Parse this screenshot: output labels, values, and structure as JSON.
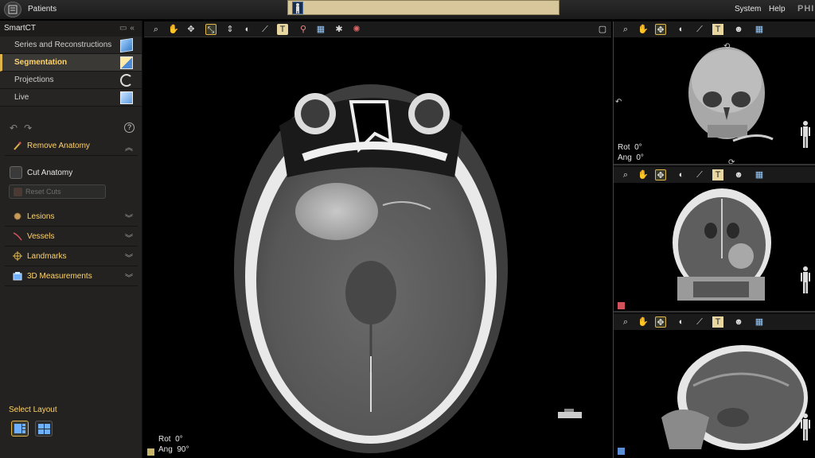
{
  "topbar": {
    "patients_label": "Patients",
    "system_label": "System",
    "help_label": "Help",
    "brand_label": "PHI"
  },
  "left_panel": {
    "title": "SmartCT",
    "nav": [
      {
        "label": "Series and Reconstructions",
        "icon": "cube-icon"
      },
      {
        "label": "Segmentation",
        "icon": "segmentation-cube-icon",
        "active": true
      },
      {
        "label": "Projections",
        "icon": "rotate-icon"
      },
      {
        "label": "Live",
        "icon": "live-icon"
      }
    ],
    "help_glyph": "?",
    "remove_anatomy": "Remove Anatomy",
    "cut_anatomy": "Cut Anatomy",
    "reset_cuts": "Reset Cuts",
    "sections": [
      {
        "label": "Lesions",
        "icon": "lesion-icon"
      },
      {
        "label": "Vessels",
        "icon": "vessel-icon"
      },
      {
        "label": "Landmarks",
        "icon": "landmark-icon"
      },
      {
        "label": "3D Measurements",
        "icon": "measurement-icon"
      }
    ],
    "select_layout": "Select Layout"
  },
  "main_view": {
    "rot_label": "Rot",
    "rot_value": "0°",
    "ang_label": "Ang",
    "ang_value": "90°",
    "swatch_color": "#c9b56a"
  },
  "view_3d": {
    "rot_label": "Rot",
    "rot_value": "0°",
    "ang_label": "Ang",
    "ang_value": "0°"
  },
  "view_coronal": {
    "swatch_color": "#d0525a"
  },
  "view_sagittal": {
    "swatch_color": "#5a8fd6"
  },
  "colors": {
    "accent": "#e0b54a",
    "active_text": "#ffd36b"
  }
}
